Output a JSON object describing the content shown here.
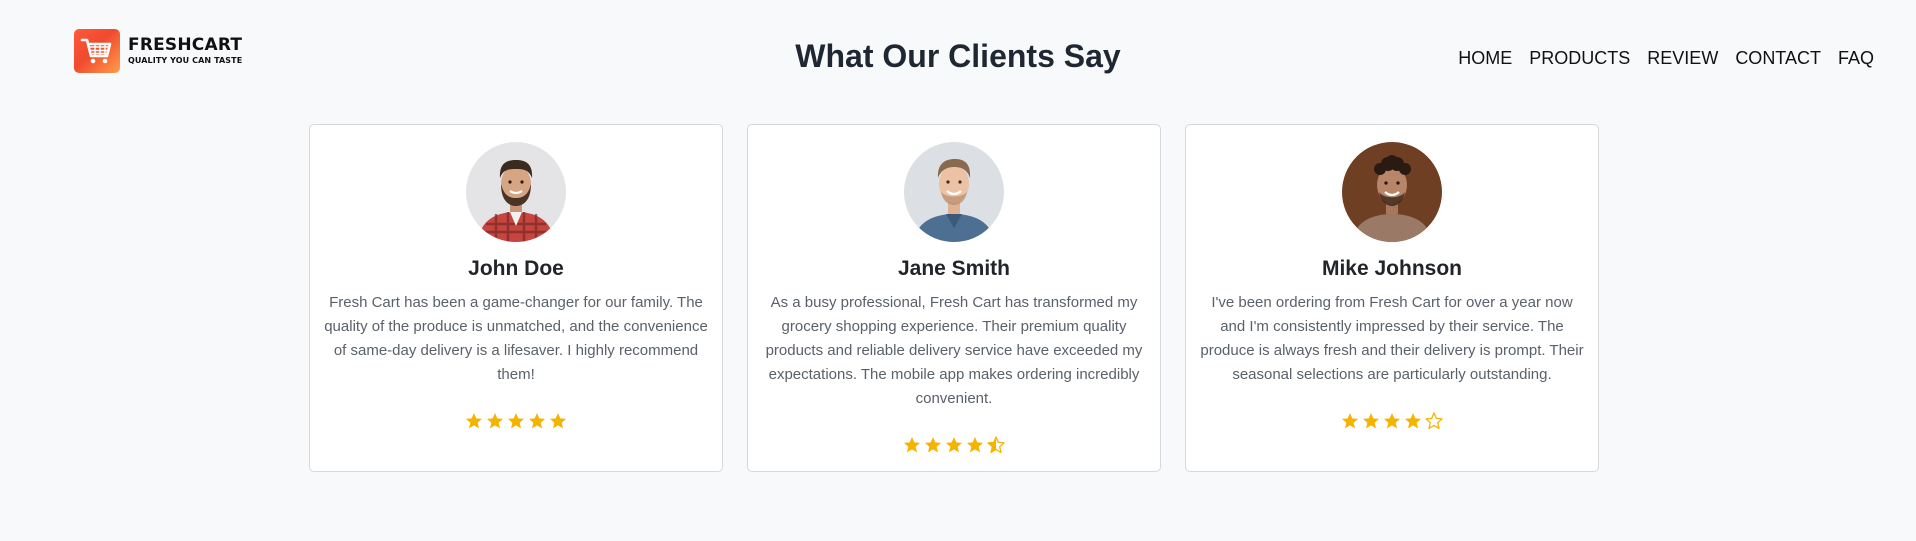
{
  "brand": {
    "name": "FRESHCART",
    "tagline": "QUALITY YOU CAN TASTE",
    "colors": {
      "accent": "#f04a2e",
      "accent_light": "#ff9e4a"
    }
  },
  "page_title": "What Our Clients Say",
  "nav": {
    "items": [
      {
        "label": "HOME"
      },
      {
        "label": "PRODUCTS"
      },
      {
        "label": "REVIEW"
      },
      {
        "label": "CONTACT"
      },
      {
        "label": "FAQ"
      }
    ]
  },
  "testimonials": [
    {
      "name": "John Doe",
      "text": "Fresh Cart has been a game-changer for our family. The quality of the produce is unmatched, and the convenience of same-day delivery is a lifesaver. I highly recommend them!",
      "rating": 5,
      "avatar_icon": "avatar-man-plaid-shirt"
    },
    {
      "name": "Jane Smith",
      "text": "As a busy professional, Fresh Cart has transformed my grocery shopping experience. Their premium quality products and reliable delivery service have exceeded my expectations. The mobile app makes ordering incredibly convenient.",
      "rating": 4.5,
      "avatar_icon": "avatar-man-blue-shirt"
    },
    {
      "name": "Mike Johnson",
      "text": "I've been ordering from Fresh Cart for over a year now and I'm consistently impressed by their service. The produce is always fresh and their delivery is prompt. Their seasonal selections are particularly outstanding.",
      "rating": 4,
      "avatar_icon": "avatar-man-curly-hair"
    }
  ],
  "star_color": "#f5b400"
}
